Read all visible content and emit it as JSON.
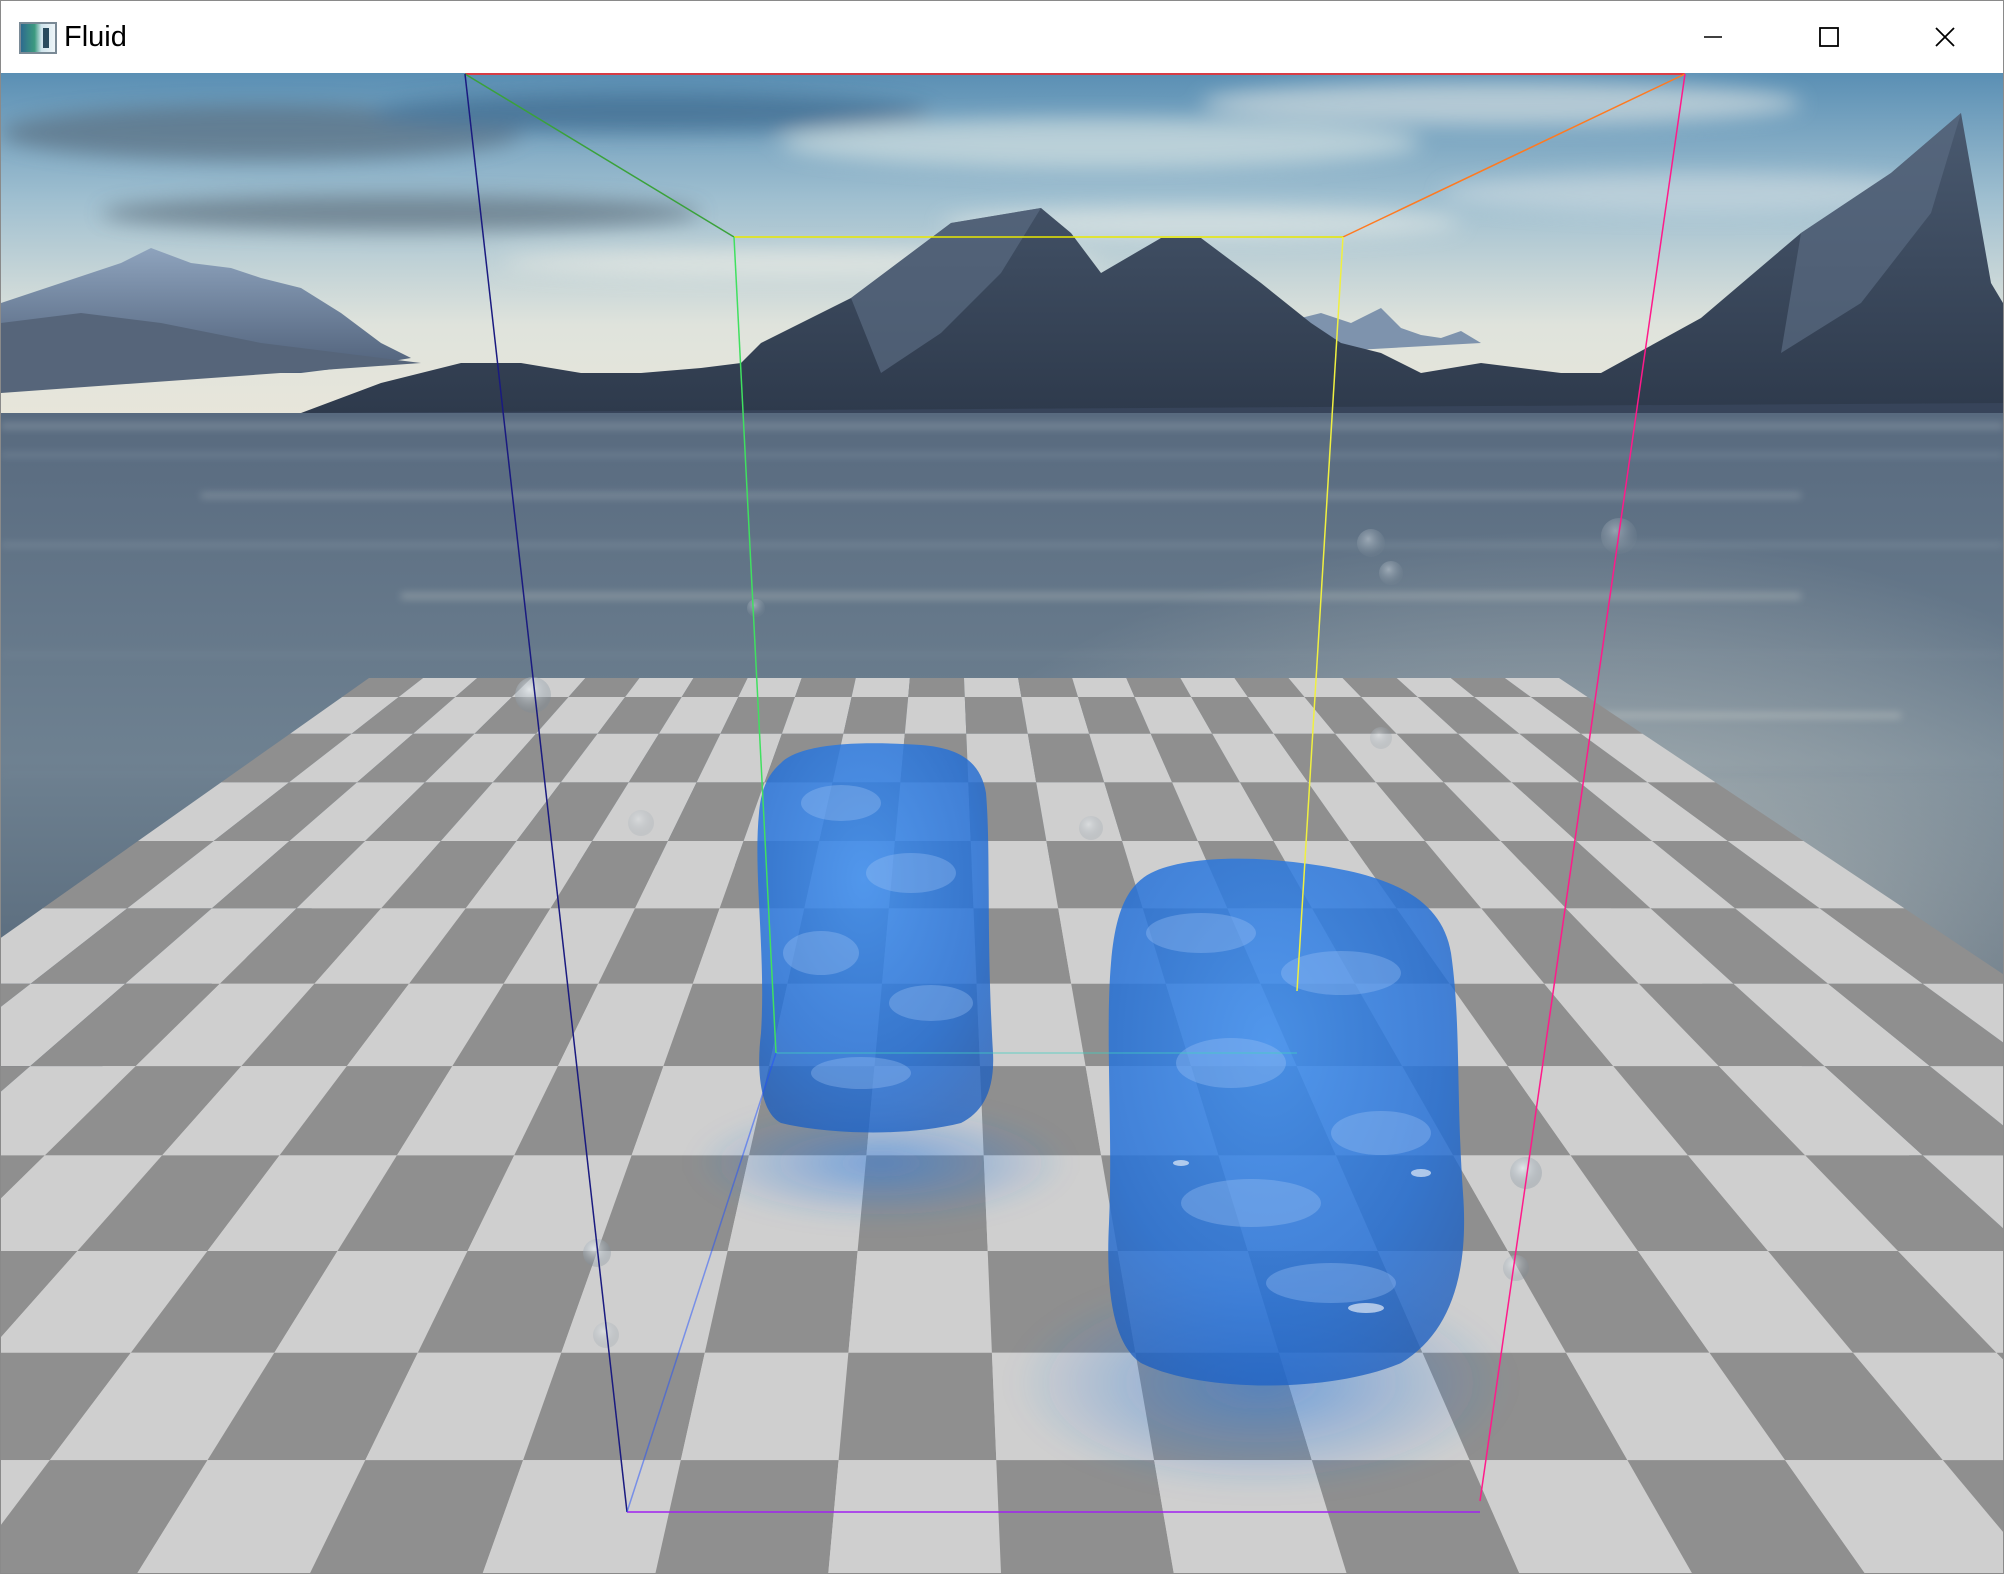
{
  "window": {
    "title": "Fluid",
    "app_icon": "fluid-app-icon",
    "controls": [
      {
        "name": "minimize-button",
        "icon": "minimize-icon"
      },
      {
        "name": "maximize-button",
        "icon": "maximize-icon"
      },
      {
        "name": "close-button",
        "icon": "close-icon"
      }
    ]
  },
  "scene": {
    "description_type": "3d-render",
    "environment": "mountain-lake-skybox",
    "floor": "checkerboard",
    "bounding_box_colors": {
      "top_left_edge": "#000000",
      "top_right_edge": "#ff2020",
      "back_top": "#ffff00",
      "back_left": "#00ff00",
      "front_left": "#0000ff",
      "front_right": "#ff00ff"
    },
    "fluid_color": "#2a7ae0",
    "checker_light": "#cfcfcf",
    "checker_dark": "#8f8f8f"
  }
}
